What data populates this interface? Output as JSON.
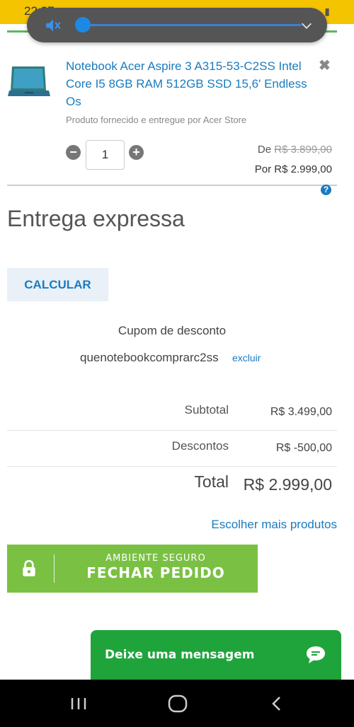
{
  "status_bar": {
    "time": "22:27"
  },
  "volume_overlay": {
    "level": 0.0
  },
  "product": {
    "title": "Notebook Acer Aspire 3 A315-53-C2SS Intel Core I5 8GB RAM 512GB SSD 15,6' Endless Os",
    "vendor": "Produto fornecido e entregue por Acer Store",
    "quantity": "1",
    "price_old_prefix": "De",
    "price_old": "R$ 3.899,00",
    "price_new": "Por R$ 2.999,00"
  },
  "shipping": {
    "title": "Entrega expressa",
    "help_icon": "?",
    "calculate_label": "CALCULAR"
  },
  "coupon": {
    "label": "Cupom de desconto",
    "code": "quenotebookcomprarc2ss",
    "remove_label": "excluir"
  },
  "summary": {
    "subtotal_label": "Subtotal",
    "subtotal_value": "R$ 3.499,00",
    "discounts_label": "Descontos",
    "discounts_value": "R$ -500,00",
    "total_label": "Total",
    "total_value": "R$ 2.999,00"
  },
  "more_products_label": "Escolher mais produtos",
  "checkout": {
    "secure_label": "AMBIENTE SEGURO",
    "button_label": "FECHAR PEDIDO"
  },
  "chat": {
    "label": "Deixe uma mensagem"
  },
  "colors": {
    "accent_blue": "#1a7bbf",
    "checkout_green": "#7ac143",
    "chat_green": "#1fa43c",
    "status_bar": "#f5c400"
  },
  "icons": [
    "volume-mute-icon",
    "chevron-down-icon",
    "close-icon",
    "minus-icon",
    "plus-icon",
    "help-icon",
    "lock-icon",
    "chat-bubble-icon",
    "recents-icon",
    "home-icon",
    "back-icon"
  ]
}
